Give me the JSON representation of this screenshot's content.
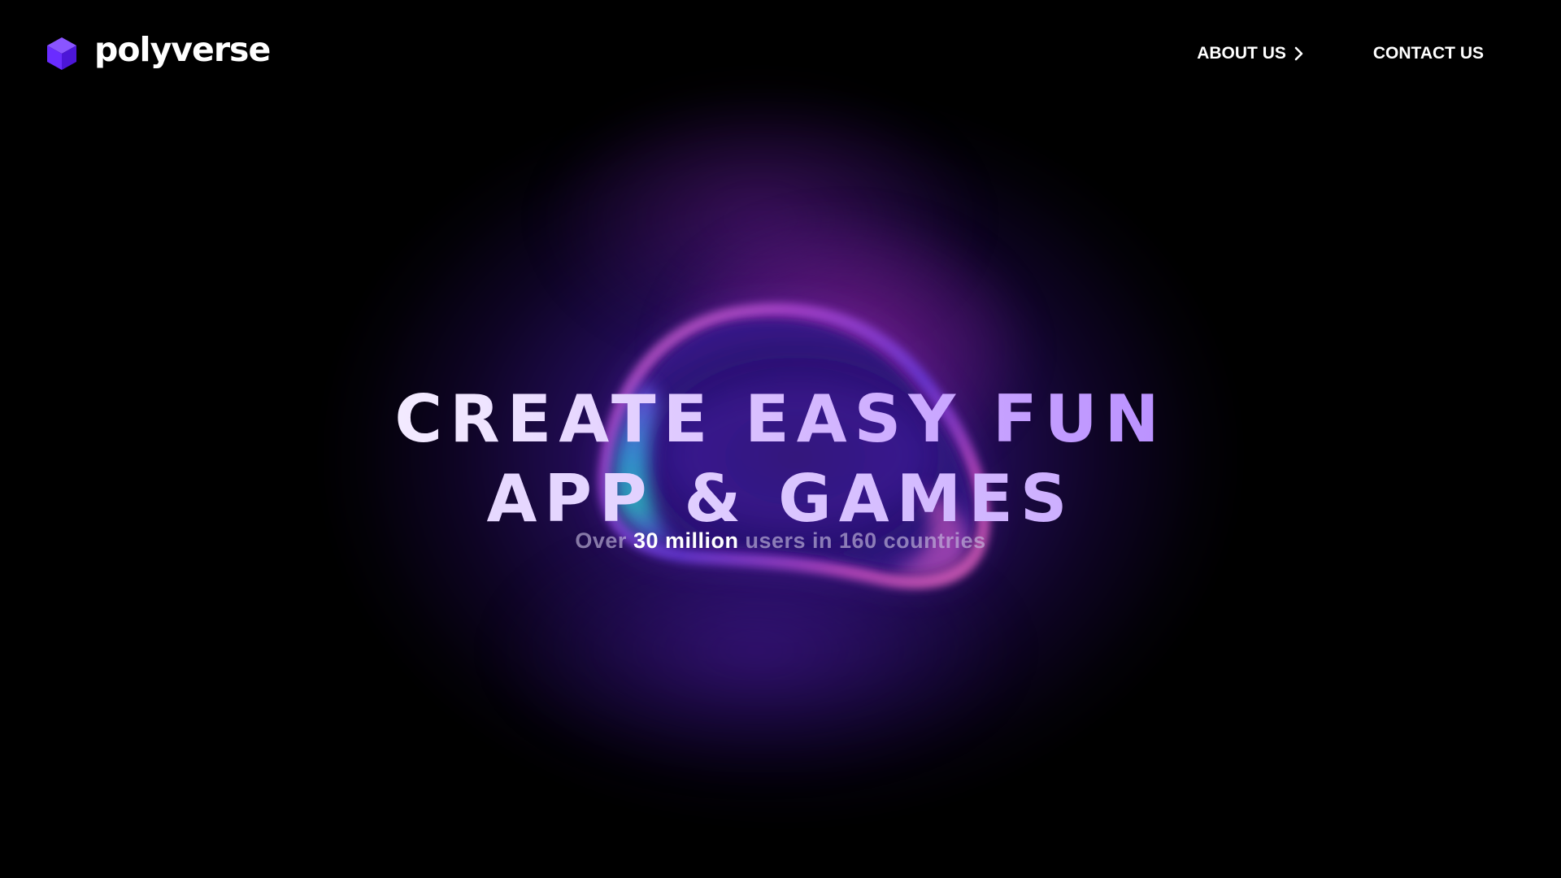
{
  "brand": {
    "name": "polyverse",
    "logo_icon": "purple-cube-icon",
    "color": "#6a2cff"
  },
  "nav": {
    "about_label": "ABOUT US",
    "about_icon": "chevron-right-icon",
    "contact_label": "CONTACT US"
  },
  "hero": {
    "line1": "CREATE EASY FUN",
    "line2": "APP & GAMES"
  },
  "stats": {
    "prefix": "Over",
    "highlight": "30 million",
    "suffix": "users in 160 countries"
  },
  "colors": {
    "background": "#000000",
    "accent_purple": "#a679ff",
    "glow_blue": "#4a1eb4",
    "glow_magenta": "#aa28aa",
    "glow_teal": "#2ad3c8"
  }
}
